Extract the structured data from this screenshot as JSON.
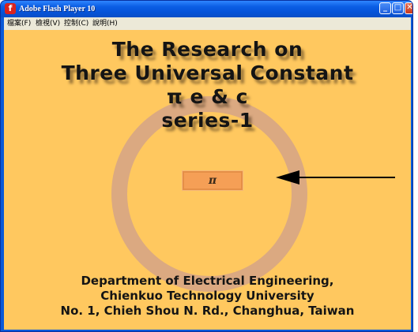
{
  "window": {
    "title": "Adobe Flash Player 10",
    "icon": "flash-icon",
    "controls": {
      "minimize": "_",
      "maximize": "□",
      "close": "✕"
    }
  },
  "menu": {
    "items": [
      {
        "label": "檔案(F)"
      },
      {
        "label": "檢視(V)"
      },
      {
        "label": "控制(C)"
      },
      {
        "label": "說明(H)"
      }
    ]
  },
  "content": {
    "title_lines": [
      "The Research on",
      "Three Universal Constant",
      "π e & c",
      "series-1"
    ],
    "pi_button_label": "π",
    "footer_lines": [
      "Department of Electrical Engineering,",
      "Chienkuo Technology University",
      "No. 1, Chieh Shou N. Rd., Changhua, Taiwan"
    ]
  },
  "colors": {
    "stage_background": "#ffc85f",
    "ring": "#dba981",
    "button": "#f59f56",
    "text": "#141414"
  }
}
